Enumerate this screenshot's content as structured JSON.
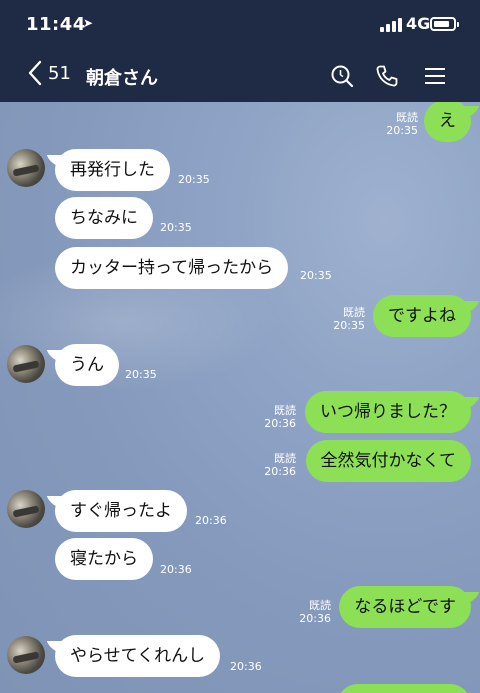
{
  "status": {
    "time": "11:44",
    "network": "4G"
  },
  "header": {
    "back_count": "51",
    "title": "朝倉さん"
  },
  "chat": {
    "read_label": "既読",
    "messages": [
      {
        "dir": "out",
        "text": "え",
        "time": "20:35",
        "read": true
      },
      {
        "dir": "in",
        "text": "再発行した",
        "time": "20:35",
        "avatar": true
      },
      {
        "dir": "in",
        "text": "ちなみに",
        "time": "20:35"
      },
      {
        "dir": "in",
        "text": "カッター持って帰ったから",
        "time": "20:35"
      },
      {
        "dir": "out",
        "text": "ですよね",
        "time": "20:35",
        "read": true
      },
      {
        "dir": "in",
        "text": "うん",
        "time": "20:35",
        "avatar": true
      },
      {
        "dir": "out",
        "text": "いつ帰りました？",
        "time": "20:36",
        "read": true
      },
      {
        "dir": "out",
        "text": "全然気付かなくて",
        "time": "20:36",
        "read": true
      },
      {
        "dir": "in",
        "text": "すぐ帰ったよ",
        "time": "20:36",
        "avatar": true
      },
      {
        "dir": "in",
        "text": "寝たから",
        "time": "20:36"
      },
      {
        "dir": "out",
        "text": "なるほどです",
        "time": "20:36",
        "read": true
      },
      {
        "dir": "in",
        "text": "やらせてくれんし",
        "time": "20:36",
        "avatar": true
      }
    ]
  },
  "colors": {
    "header_bg": "#1f2a44",
    "outgoing_bubble": "#8de055",
    "incoming_bubble": "#ffffff",
    "chat_bg": "#8599bc"
  },
  "icons": [
    "location-arrow-icon",
    "signal-icon",
    "battery-icon",
    "back-chevron-icon",
    "search-icon",
    "phone-icon",
    "menu-icon"
  ]
}
